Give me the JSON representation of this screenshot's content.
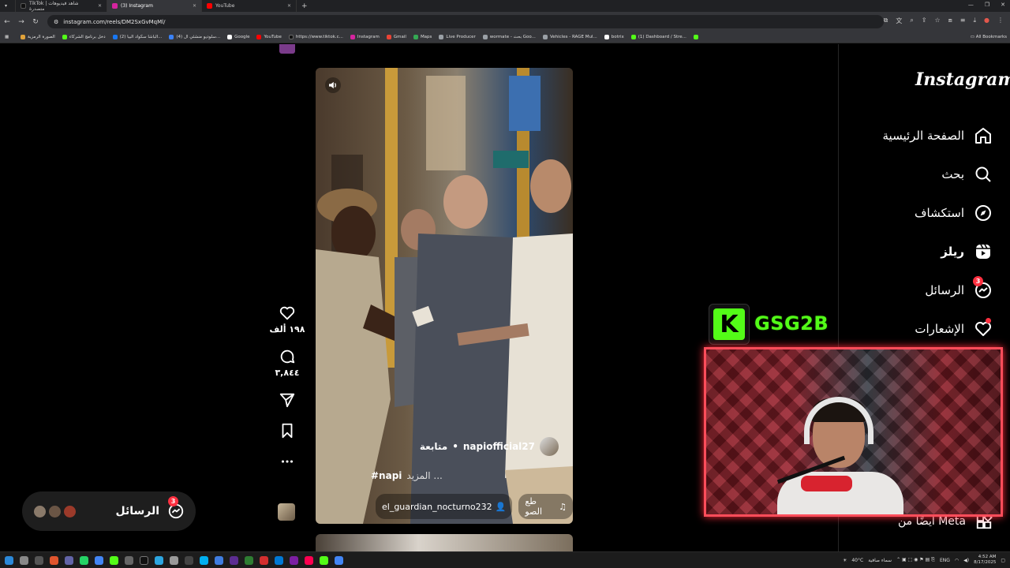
{
  "browser": {
    "tabs": [
      {
        "label": "TikTok | شاهد فيديوهات متصدرة",
        "color": "#111111",
        "active": false
      },
      {
        "label": "(3) Instagram",
        "color": "#d6249f",
        "active": true
      },
      {
        "label": "YouTube",
        "color": "#ff0000",
        "active": false
      }
    ],
    "url": "instagram.com/reels/DM2SxGvMqMl/",
    "all_bookmarks": "All Bookmarks",
    "bookmarks": [
      {
        "label": "الصورة الرمزية",
        "color": "#e0a23a"
      },
      {
        "label": "دخل برنامج الشركاء",
        "color": "#53fc18"
      },
      {
        "label": "(2) الباشا سكواد البيا...",
        "color": "#1877f2"
      },
      {
        "label": "(4) سلوديو منشئي ال...",
        "color": "#3b82f6"
      },
      {
        "label": "Google",
        "color": "#ffffff"
      },
      {
        "label": "YouTube",
        "color": "#ff0000"
      },
      {
        "label": "https://www.tiktok.c...",
        "color": "#111111"
      },
      {
        "label": "Instagram",
        "color": "#d6249f"
      },
      {
        "label": "Gmail",
        "color": "#ea4335"
      },
      {
        "label": "Maps",
        "color": "#34a853"
      },
      {
        "label": "Live Producer",
        "color": "#9aa0a6"
      },
      {
        "label": "wormate - بحث Goo...",
        "color": "#9aa0a6"
      },
      {
        "label": "Vehicles - RAGE Mul...",
        "color": "#9aa0a6"
      },
      {
        "label": "botrix",
        "color": "#ffffff"
      },
      {
        "label": "(1) Dashboard / Stre...",
        "color": "#53fc18"
      },
      {
        "label": "",
        "color": "#53fc18"
      }
    ]
  },
  "reel": {
    "author": "napiofficial27",
    "follow": "متابعة",
    "caption_more": "المزيد ...",
    "caption_tag": "#napi",
    "tagged_user": "el_guardian_nocturno232",
    "audio": "طع الصو"
  },
  "actions": {
    "likes": "١٩٨ ألف",
    "comments": "٣,٨٤٤"
  },
  "messages_pill": {
    "label": "الرسائل",
    "badge": "3"
  },
  "sidebar": {
    "logo": "Instagram",
    "items": [
      {
        "label": "الصفحة الرئيسية",
        "icon": "home-icon"
      },
      {
        "label": "بحث",
        "icon": "search-icon"
      },
      {
        "label": "استكشاف",
        "icon": "compass-icon"
      },
      {
        "label": "ريلز",
        "icon": "reels-icon"
      },
      {
        "label": "الرسائل",
        "icon": "messenger-icon",
        "badge": "3"
      },
      {
        "label": "الإشعارات",
        "icon": "heart-icon"
      }
    ],
    "also_from": "أيضًا من Meta"
  },
  "stream_overlay": {
    "channel": "GSG2B",
    "logo_letter": "K",
    "accent": "#53fc18",
    "frame_color": "#ff4d5a"
  },
  "taskbar": {
    "weather": "40°C",
    "weather_text": "سماء صافية",
    "lang": "ENG",
    "time": "4:52 AM",
    "date": "8/17/2025"
  }
}
